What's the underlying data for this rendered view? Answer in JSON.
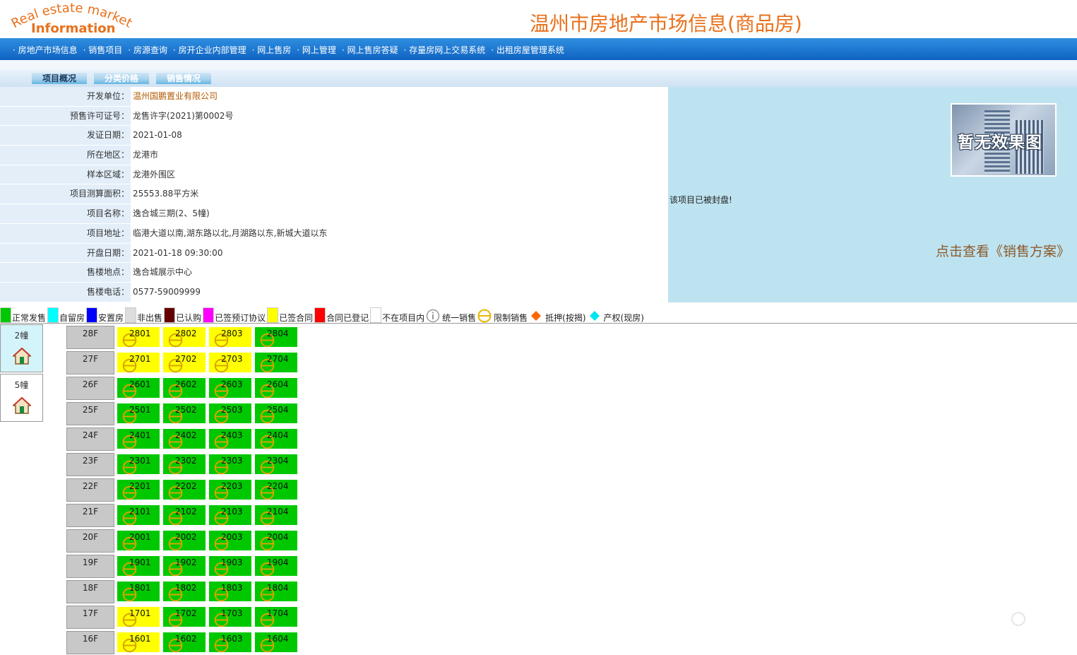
{
  "header": {
    "logo_arc_text": "Real estate market",
    "logo_word": "Information",
    "title": "温州市房地产市场信息(商品房)"
  },
  "nav": {
    "items": [
      "房地产市场信息",
      "销售项目",
      "房源查询",
      "房开企业内部管理",
      "网上售房",
      "网上管理",
      "网上售房答疑",
      "存量房网上交易系统",
      "出租房屋管理系统"
    ]
  },
  "tabs": [
    {
      "label": "项目概况",
      "active": true
    },
    {
      "label": "分类价格",
      "active": false
    },
    {
      "label": "销售情况",
      "active": false
    }
  ],
  "project": {
    "fields": [
      {
        "label": "开发单位：",
        "value": "温州国鹏置业有限公司",
        "link": true
      },
      {
        "label": "预售许可证号：",
        "value": "龙售许字(2021)第0002号"
      },
      {
        "label": "发证日期：",
        "value": "2021-01-08"
      },
      {
        "label": "所在地区：",
        "value": "龙港市"
      },
      {
        "label": "样本区域：",
        "value": "龙港外围区"
      },
      {
        "label": "项目测算面积：",
        "value": "25553.88平方米"
      },
      {
        "label": "项目名称：",
        "value": "逸合城三期(2、5幢)"
      },
      {
        "label": "项目地址：",
        "value": "临港大道以南,湖东路以北,月湖路以东,新城大道以东"
      },
      {
        "label": "开盘日期：",
        "value": "2021-01-18 09:30:00"
      },
      {
        "label": "售楼地点：",
        "value": "逸合城展示中心"
      },
      {
        "label": "售楼电话：",
        "value": "0577-59009999"
      }
    ]
  },
  "side": {
    "thumbnail_caption": "暂无效果图",
    "sealed_text": "该项目已被封盘!",
    "plan_link": "点击查看《销售方案》"
  },
  "legend": [
    {
      "label": "正常发售",
      "color": "#00c800",
      "kind": "swatch"
    },
    {
      "label": "自留房",
      "color": "#00ffff",
      "kind": "swatch"
    },
    {
      "label": "安置房",
      "color": "#0000ff",
      "kind": "swatch"
    },
    {
      "label": "非出售",
      "color": "#dddddd",
      "kind": "swatch"
    },
    {
      "label": "已认购",
      "color": "#660000",
      "kind": "swatch"
    },
    {
      "label": "已签预订协议",
      "color": "#ff00ff",
      "kind": "swatch"
    },
    {
      "label": "已签合同",
      "color": "#ffff00",
      "kind": "swatch"
    },
    {
      "label": "合同已登记",
      "color": "#ff0000",
      "kind": "swatch"
    },
    {
      "label": "不在项目内",
      "color": "#ffffff",
      "kind": "swatch"
    },
    {
      "label": "统一销售",
      "color": "#999999",
      "kind": "info-icon"
    },
    {
      "label": "限制销售",
      "color": "#e6b800",
      "kind": "limit-icon"
    },
    {
      "label": "抵押(按揭)",
      "color": "#ff6600",
      "kind": "diamond-icon"
    },
    {
      "label": "产权(现房)",
      "color": "#00e5ee",
      "kind": "diamond-icon"
    }
  ],
  "buildings": [
    {
      "label": "2幢",
      "active": true
    },
    {
      "label": "5幢",
      "active": false
    }
  ],
  "floors": [
    {
      "floor": "28F",
      "units": [
        {
          "no": "2801",
          "status": "yellow"
        },
        {
          "no": "2802",
          "status": "yellow"
        },
        {
          "no": "2803",
          "status": "yellow"
        },
        {
          "no": "2804",
          "status": "green"
        }
      ]
    },
    {
      "floor": "27F",
      "units": [
        {
          "no": "2701",
          "status": "yellow"
        },
        {
          "no": "2702",
          "status": "yellow"
        },
        {
          "no": "2703",
          "status": "yellow"
        },
        {
          "no": "2704",
          "status": "green"
        }
      ]
    },
    {
      "floor": "26F",
      "units": [
        {
          "no": "2601",
          "status": "green"
        },
        {
          "no": "2602",
          "status": "green"
        },
        {
          "no": "2603",
          "status": "green"
        },
        {
          "no": "2604",
          "status": "green"
        }
      ]
    },
    {
      "floor": "25F",
      "units": [
        {
          "no": "2501",
          "status": "green"
        },
        {
          "no": "2502",
          "status": "green"
        },
        {
          "no": "2503",
          "status": "green"
        },
        {
          "no": "2504",
          "status": "green"
        }
      ]
    },
    {
      "floor": "24F",
      "units": [
        {
          "no": "2401",
          "status": "green"
        },
        {
          "no": "2402",
          "status": "green"
        },
        {
          "no": "2403",
          "status": "green"
        },
        {
          "no": "2404",
          "status": "green"
        }
      ]
    },
    {
      "floor": "23F",
      "units": [
        {
          "no": "2301",
          "status": "green"
        },
        {
          "no": "2302",
          "status": "green"
        },
        {
          "no": "2303",
          "status": "green"
        },
        {
          "no": "2304",
          "status": "green"
        }
      ]
    },
    {
      "floor": "22F",
      "units": [
        {
          "no": "2201",
          "status": "green"
        },
        {
          "no": "2202",
          "status": "green"
        },
        {
          "no": "2203",
          "status": "green"
        },
        {
          "no": "2204",
          "status": "green"
        }
      ]
    },
    {
      "floor": "21F",
      "units": [
        {
          "no": "2101",
          "status": "green"
        },
        {
          "no": "2102",
          "status": "green"
        },
        {
          "no": "2103",
          "status": "green"
        },
        {
          "no": "2104",
          "status": "green"
        }
      ]
    },
    {
      "floor": "20F",
      "units": [
        {
          "no": "2001",
          "status": "green"
        },
        {
          "no": "2002",
          "status": "green"
        },
        {
          "no": "2003",
          "status": "green"
        },
        {
          "no": "2004",
          "status": "green"
        }
      ]
    },
    {
      "floor": "19F",
      "units": [
        {
          "no": "1901",
          "status": "green"
        },
        {
          "no": "1902",
          "status": "green"
        },
        {
          "no": "1903",
          "status": "green"
        },
        {
          "no": "1904",
          "status": "green"
        }
      ]
    },
    {
      "floor": "18F",
      "units": [
        {
          "no": "1801",
          "status": "green"
        },
        {
          "no": "1802",
          "status": "green"
        },
        {
          "no": "1803",
          "status": "green"
        },
        {
          "no": "1804",
          "status": "green"
        }
      ]
    },
    {
      "floor": "17F",
      "units": [
        {
          "no": "1701",
          "status": "yellow"
        },
        {
          "no": "1702",
          "status": "green"
        },
        {
          "no": "1703",
          "status": "green"
        },
        {
          "no": "1704",
          "status": "green"
        }
      ]
    },
    {
      "floor": "16F",
      "units": [
        {
          "no": "1601",
          "status": "yellow"
        },
        {
          "no": "1602",
          "status": "green"
        },
        {
          "no": "1603",
          "status": "green"
        },
        {
          "no": "1604",
          "status": "green"
        }
      ]
    }
  ]
}
